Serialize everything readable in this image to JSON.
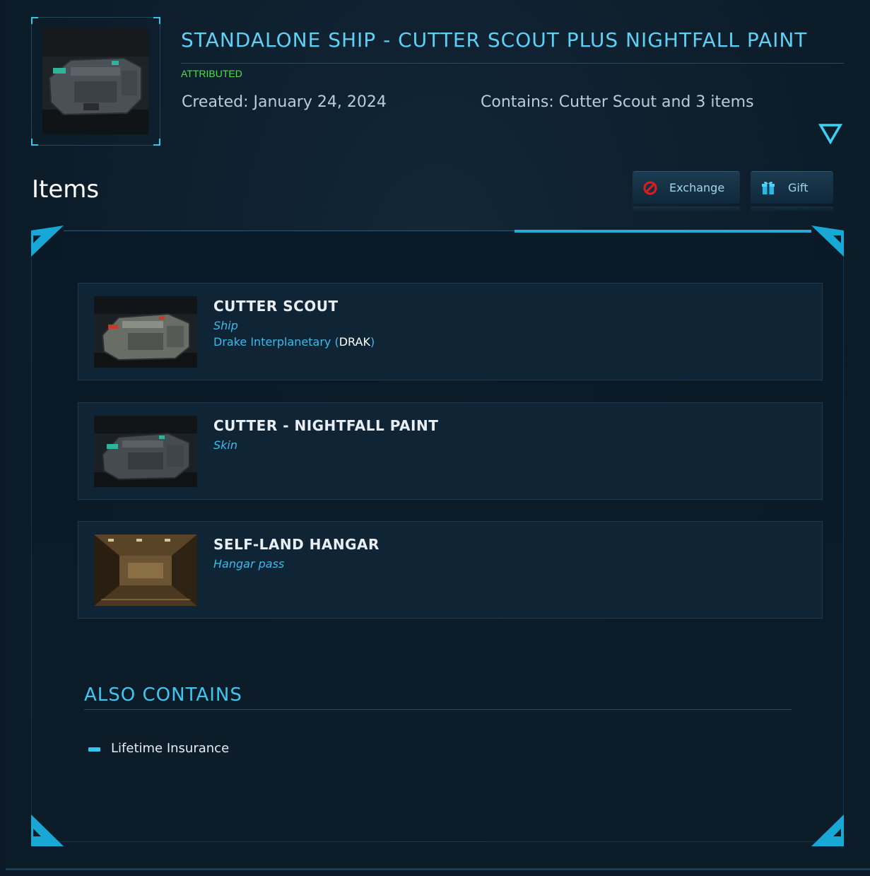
{
  "pledge": {
    "title": "STANDALONE SHIP - CUTTER SCOUT PLUS NIGHTFALL PAINT",
    "status": "ATTRIBUTED",
    "created": "Created: January 24, 2024",
    "contains": "Contains: Cutter Scout and 3 items",
    "thumbnail_icon": "ship-thumbnail",
    "toggle_icon": "expand-triangle-icon"
  },
  "items_section": {
    "title": "Items",
    "exchange_label": "Exchange",
    "gift_label": "Gift"
  },
  "items": [
    {
      "name": "CUTTER SCOUT",
      "type": "Ship",
      "manufacturer": "Drake Interplanetary (",
      "manufacturer_code": "DRAK",
      "manufacturer_close": ")"
    },
    {
      "name": "CUTTER - NIGHTFALL PAINT",
      "type": "Skin"
    },
    {
      "name": "SELF-LAND HANGAR",
      "type": "Hangar pass"
    }
  ],
  "also_contains": {
    "title": "ALSO CONTAINS",
    "items": [
      "Lifetime Insurance"
    ]
  },
  "colors": {
    "accent": "#35c5f2",
    "title": "#5fd0f5",
    "attributed": "#4de04d",
    "background": "#0c1b28"
  }
}
